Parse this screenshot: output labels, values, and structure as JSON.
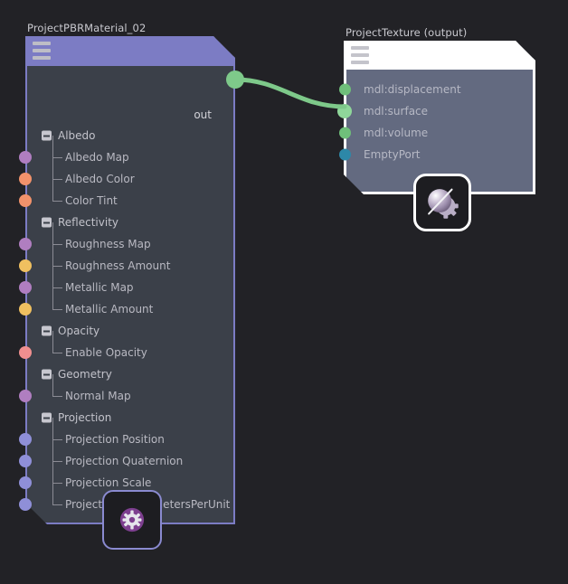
{
  "canvas": {
    "background": "#222226"
  },
  "colors": {
    "node_border": "#7c7cc4",
    "node_header": "#7c7cc4",
    "node_body": "#3b4049",
    "selected_border": "#ffffff",
    "output_node_body": "#636a80",
    "wire": "#7ec98a",
    "port_map": "#b07ec0",
    "port_color": "#f2926b",
    "port_amount": "#f0c060",
    "port_bool": "#f08f8f",
    "port_projection": "#8f8fd8",
    "port_green": "#6fbf7a",
    "port_green_bright": "#8fd69a",
    "port_teal": "#2d88a8"
  },
  "nodes": [
    {
      "id": "pbr",
      "title": "ProjectPBRMaterial_02",
      "selected": false,
      "menu_icon": "hamburger-icon",
      "output_label": "out",
      "badge_icon": "gear-icon",
      "rows": [
        {
          "label": "Albedo",
          "kind": "group"
        },
        {
          "label": "Albedo Map",
          "kind": "leaf",
          "port": "port_map",
          "last": false
        },
        {
          "label": "Albedo Color",
          "kind": "leaf",
          "port": "port_color",
          "last": false
        },
        {
          "label": "Color Tint",
          "kind": "leaf",
          "port": "port_color",
          "last": true
        },
        {
          "label": "Reflectivity",
          "kind": "group"
        },
        {
          "label": "Roughness Map",
          "kind": "leaf",
          "port": "port_map",
          "last": false
        },
        {
          "label": "Roughness Amount",
          "kind": "leaf",
          "port": "port_amount",
          "last": false
        },
        {
          "label": "Metallic Map",
          "kind": "leaf",
          "port": "port_map",
          "last": false
        },
        {
          "label": "Metallic Amount",
          "kind": "leaf",
          "port": "port_amount",
          "last": true
        },
        {
          "label": "Opacity",
          "kind": "group"
        },
        {
          "label": "Enable Opacity",
          "kind": "leaf",
          "port": "port_bool",
          "last": true
        },
        {
          "label": "Geometry",
          "kind": "group"
        },
        {
          "label": "Normal Map",
          "kind": "leaf",
          "port": "port_map",
          "last": true
        },
        {
          "label": "Projection",
          "kind": "group"
        },
        {
          "label": "Projection Position",
          "kind": "leaf",
          "port": "port_projection",
          "last": false
        },
        {
          "label": "Projection Quaternion",
          "kind": "leaf",
          "port": "port_projection",
          "last": false
        },
        {
          "label": "Projection Scale",
          "kind": "leaf",
          "port": "port_projection",
          "last": false
        },
        {
          "label": "Projection StageMetersPerUnit",
          "kind": "leaf",
          "port": "port_projection",
          "last": true
        }
      ]
    },
    {
      "id": "tex",
      "title": "ProjectTexture (output)",
      "selected": true,
      "menu_icon": "hamburger-icon",
      "badge_icon": "material-preview-icon",
      "rows": [
        {
          "label": "mdl:displacement",
          "port": "port_green",
          "connected": false
        },
        {
          "label": "mdl:surface",
          "port": "port_green_bright",
          "connected": true
        },
        {
          "label": "mdl:volume",
          "port": "port_green",
          "connected": false
        },
        {
          "label": "EmptyPort",
          "port": "port_teal",
          "connected": false
        }
      ]
    }
  ],
  "connections": [
    {
      "from": "ProjectPBRMaterial_02.out",
      "to": "ProjectTexture.mdl:surface",
      "color": "#7ec98a"
    }
  ]
}
